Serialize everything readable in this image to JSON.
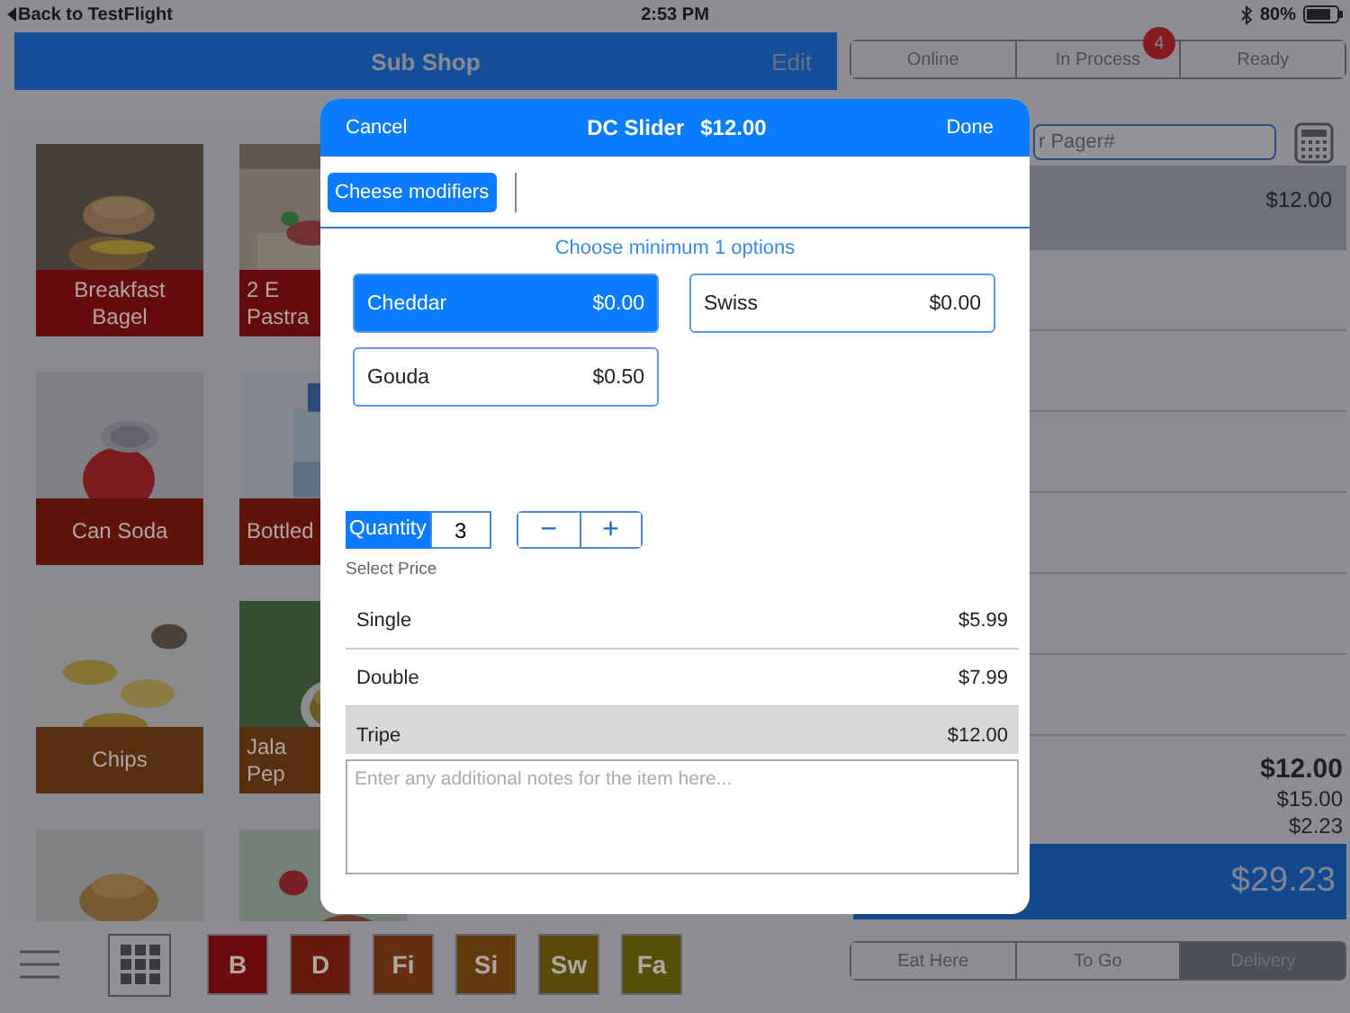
{
  "status_bar": {
    "back": "Back to TestFlight",
    "time": "2:53 PM",
    "battery": "80%"
  },
  "shop": {
    "title": "Sub Shop",
    "edit": "Edit"
  },
  "menu_items": [
    {
      "kind": "picture",
      "lines": [
        "Breakfast",
        "Bagel"
      ],
      "color": "#640c0c"
    },
    {
      "kind": "picture",
      "lines": [
        "2 E",
        "Pastra"
      ],
      "color": "#640c0c"
    },
    {
      "kind": "picture",
      "lines": [
        "Can Soda"
      ],
      "color": "#5e1408"
    },
    {
      "kind": "picture",
      "lines": [
        "Bottled"
      ],
      "color": "#5e1408"
    },
    {
      "kind": "picture",
      "lines": [
        "Chips"
      ],
      "color": "#583010"
    },
    {
      "kind": "picture",
      "lines": [
        "Jala",
        "Pep"
      ],
      "color": "#583010"
    },
    {
      "kind": "picture"
    },
    {
      "kind": "picture"
    }
  ],
  "categories": [
    {
      "label": "B",
      "color": "#6c0c0c"
    },
    {
      "label": "D",
      "color": "#681a0a"
    },
    {
      "label": "Fi",
      "color": "#643010"
    },
    {
      "label": "Si",
      "color": "#603c0c"
    },
    {
      "label": "Sw",
      "color": "#584a08"
    },
    {
      "label": "Fa",
      "color": "#555008"
    }
  ],
  "order_status_tabs": [
    {
      "label": "Online",
      "selected": false
    },
    {
      "label": "In Process",
      "selected": false,
      "badge": "4"
    },
    {
      "label": "Ready",
      "selected": false
    }
  ],
  "pager_field": {
    "placeholder": "r Pager#"
  },
  "order_lines": [
    {
      "price": "$12.00",
      "selected": true
    }
  ],
  "totals": [
    "$12.00",
    "$15.00",
    "$2.23"
  ],
  "grand_total": "$29.23",
  "service_tabs": [
    {
      "label": "Eat Here",
      "selected": false
    },
    {
      "label": "To Go",
      "selected": false
    },
    {
      "label": "Delivery",
      "selected": true
    }
  ],
  "modal": {
    "cancel": "Cancel",
    "title": "DC Slider",
    "price": "$12.00",
    "done": "Done",
    "modifier_tabs": [
      {
        "label": "Cheese modifiers",
        "selected": true
      }
    ],
    "hint": "Choose minimum 1 options",
    "options": [
      {
        "name": "Cheddar",
        "price": "$0.00",
        "selected": true
      },
      {
        "name": "Swiss",
        "price": "$0.00",
        "selected": false
      },
      {
        "name": "Gouda",
        "price": "$0.50",
        "selected": false
      }
    ],
    "quantity": {
      "label": "Quantity",
      "value": "3"
    },
    "stepper": [
      "−",
      "+"
    ],
    "price_heading": "Select Price",
    "prices": [
      {
        "name": "Single",
        "price": "$5.99",
        "selected": false
      },
      {
        "name": "Double",
        "price": "$7.99",
        "selected": false
      },
      {
        "name": "Tripe",
        "price": "$12.00",
        "selected": true
      }
    ],
    "notes": {
      "placeholder": "Enter any additional notes for the item here..."
    }
  }
}
